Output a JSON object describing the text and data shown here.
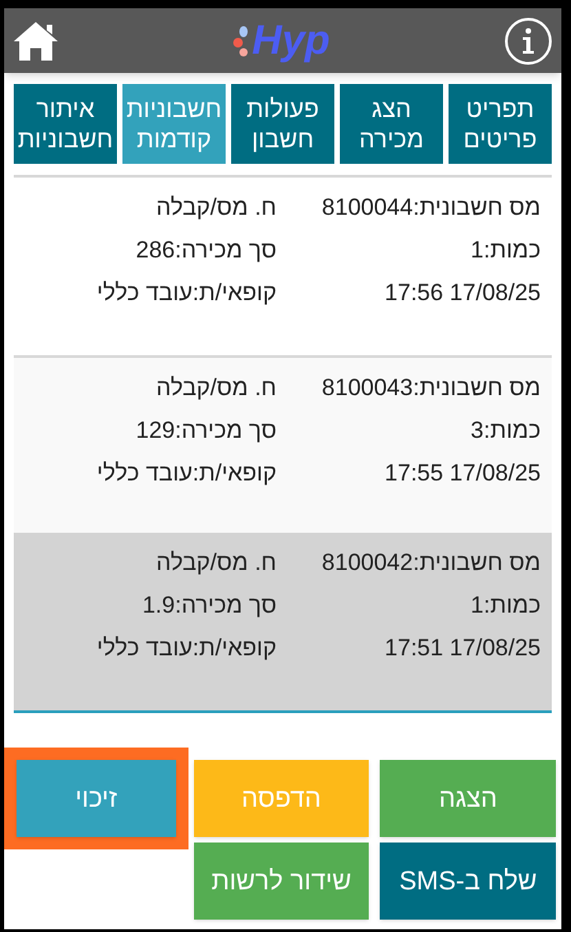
{
  "header": {
    "logo": "Hyp"
  },
  "tabs": [
    {
      "label": "תפריט פריטים",
      "selected": false
    },
    {
      "label": "הצג מכירה",
      "selected": false
    },
    {
      "label": "פעולות חשבון",
      "selected": false
    },
    {
      "label": "חשבוניות קודמות",
      "selected": true
    },
    {
      "label": "איתור חשבוניות",
      "selected": false
    }
  ],
  "invoices": [
    {
      "number": "מס חשבונית:8100044",
      "type": "ח. מס/קבלה",
      "quantity": "כמות:1",
      "total": "סך מכירה:286",
      "datetime": "17:56 17/08/25",
      "cashier": "קופאי/ת:עובד כללי",
      "selected": false
    },
    {
      "number": "מס חשבונית:8100043",
      "type": "ח. מס/קבלה",
      "quantity": "כמות:3",
      "total": "סך מכירה:129",
      "datetime": "17:55 17/08/25",
      "cashier": "קופאי/ת:עובד כללי",
      "selected": false
    },
    {
      "number": "מס חשבונית:8100042",
      "type": "ח. מס/קבלה",
      "quantity": "כמות:1",
      "total": "סך מכירה:1.9",
      "datetime": "17:51 17/08/25",
      "cashier": "קופאי/ת:עובד כללי",
      "selected": true
    }
  ],
  "actions": [
    {
      "label": "הצגה",
      "color": "#55ad52",
      "highlighted": false
    },
    {
      "label": "הדפסה",
      "color": "#fdb918",
      "highlighted": false
    },
    {
      "label": "זיכוי",
      "color": "#33a2bb",
      "highlighted": true
    },
    {
      "label": "שלח ב-SMS",
      "color": "#006d82",
      "highlighted": false
    },
    {
      "label": "שידור לרשות",
      "color": "#55ad52",
      "highlighted": false
    }
  ]
}
